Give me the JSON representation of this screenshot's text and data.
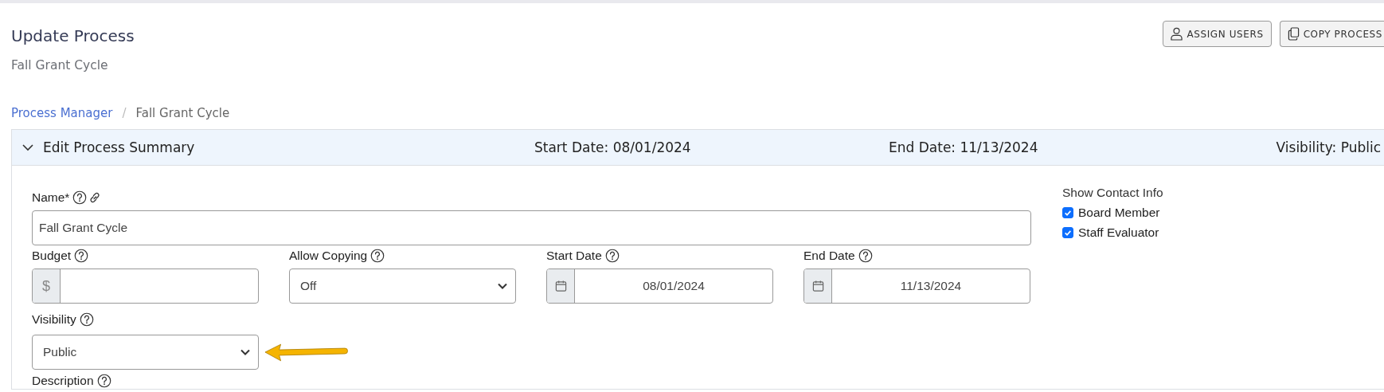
{
  "header": {
    "title": "Update Process",
    "subtitle": "Fall Grant Cycle",
    "buttons": [
      {
        "label": "ASSIGN USERS"
      },
      {
        "label": "COPY PROCESS"
      }
    ]
  },
  "breadcrumb": {
    "separator": "/",
    "items": [
      {
        "label": "Process Manager",
        "link": true
      },
      {
        "label": "Fall Grant Cycle",
        "link": false
      }
    ]
  },
  "summary": {
    "expanded": true,
    "title": "Edit Process Summary",
    "start": "Start Date: 08/01/2024",
    "end": "End Date: 11/13/2024",
    "visibility": "Visibility: Public"
  },
  "form": {
    "name": {
      "label": "Name*",
      "value": "Fall Grant Cycle"
    },
    "fields": [
      {
        "kind": "currency",
        "label": "Budget",
        "prefix": "$"
      },
      {
        "kind": "select",
        "label": "Allow Copying",
        "value": "Off"
      },
      {
        "kind": "date",
        "label": "Start Date",
        "value": "08/01/2024"
      },
      {
        "kind": "date",
        "label": "End Date",
        "value": "11/13/2024"
      }
    ],
    "visibility": {
      "label": "Visibility",
      "value": "Public"
    },
    "description": {
      "label": "Description"
    },
    "contact": {
      "label": "Show Contact Info",
      "options": [
        {
          "label": "Board Member",
          "checked": true
        },
        {
          "label": "Staff Evaluator",
          "checked": true
        }
      ]
    }
  }
}
